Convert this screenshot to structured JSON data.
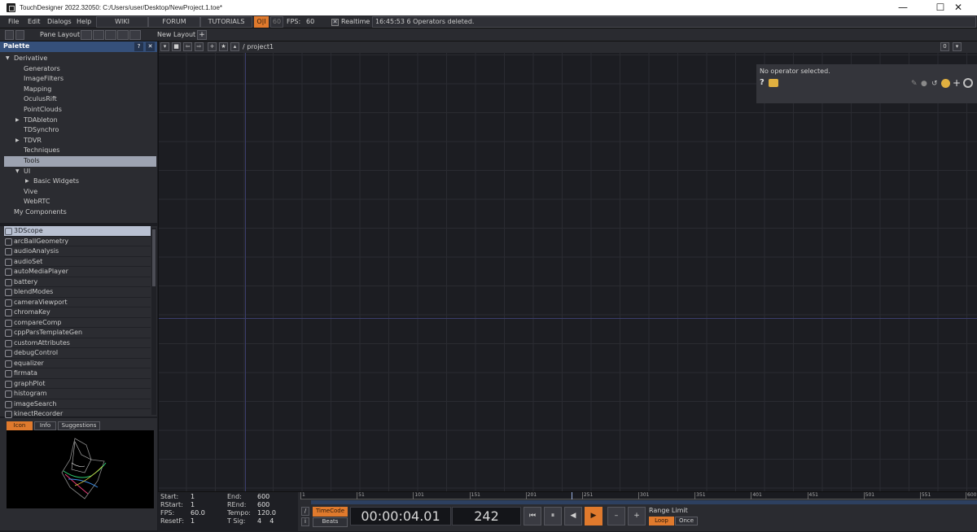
{
  "window": {
    "title": "TouchDesigner 2022.32050: C:/Users/user/Desktop/NewProject.1.toe*",
    "minimize": "—",
    "maximize": "☐",
    "close": "✕"
  },
  "menubar": {
    "items": [
      "File",
      "Edit",
      "Dialogs",
      "Help"
    ],
    "links": [
      "WIKI",
      "FORUM",
      "TUTORIALS"
    ],
    "oi": "O|I",
    "fps_box": "60",
    "fps_label": "FPS:",
    "fps_value": "60",
    "realtime_label": "Realtime",
    "status": "16:45:53 6 Operators deleted."
  },
  "toolbar": {
    "pane_layout": "Pane Layout",
    "new_layout": "New Layout",
    "add": "+"
  },
  "palette": {
    "title": "Palette",
    "help": "?",
    "close": "✕",
    "tree": [
      {
        "label": "Derivative",
        "indent": 0,
        "arrow": "▼"
      },
      {
        "label": "Generators",
        "indent": 1,
        "arrow": ""
      },
      {
        "label": "ImageFilters",
        "indent": 1,
        "arrow": ""
      },
      {
        "label": "Mapping",
        "indent": 1,
        "arrow": ""
      },
      {
        "label": "OculusRift",
        "indent": 1,
        "arrow": ""
      },
      {
        "label": "PointClouds",
        "indent": 1,
        "arrow": ""
      },
      {
        "label": "TDAbleton",
        "indent": 1,
        "arrow": "▶"
      },
      {
        "label": "TDSynchro",
        "indent": 1,
        "arrow": ""
      },
      {
        "label": "TDVR",
        "indent": 1,
        "arrow": "▶"
      },
      {
        "label": "Techniques",
        "indent": 1,
        "arrow": ""
      },
      {
        "label": "Tools",
        "indent": 1,
        "arrow": "",
        "selected": true
      },
      {
        "label": "UI",
        "indent": 1,
        "arrow": "▼"
      },
      {
        "label": "Basic Widgets",
        "indent": 2,
        "arrow": "▶"
      },
      {
        "label": "Vive",
        "indent": 1,
        "arrow": ""
      },
      {
        "label": "WebRTC",
        "indent": 1,
        "arrow": ""
      },
      {
        "label": "My Components",
        "indent": 0,
        "arrow": ""
      }
    ],
    "components": [
      "3DScope",
      "arcBallGeometry",
      "audioAnalysis",
      "audioSet",
      "autoMediaPlayer",
      "battery",
      "blendModes",
      "cameraViewport",
      "chromaKey",
      "compareComp",
      "cppParsTemplateGen",
      "customAttributes",
      "debugControl",
      "equalizer",
      "firmata",
      "graphPlot",
      "histogram",
      "imageSearch",
      "kinectRecorder"
    ],
    "selected_component": "3DScope",
    "tabs": [
      "Icon",
      "Info",
      "Suggestions"
    ],
    "active_tab": "Icon"
  },
  "network": {
    "path": "/ project1",
    "right_count": "0",
    "info_text": "No operator selected.",
    "info_help": "?"
  },
  "timeline": {
    "info": [
      {
        "k": "Start:",
        "v": "1"
      },
      {
        "k": "RStart:",
        "v": "1"
      },
      {
        "k": "FPS:",
        "v": "60.0"
      },
      {
        "k": "ResetF:",
        "v": "1"
      }
    ],
    "info2": [
      {
        "k": "End:",
        "v": "600"
      },
      {
        "k": "REnd:",
        "v": "600"
      },
      {
        "k": "Tempo:",
        "v": "120.0"
      },
      {
        "k": "T Sig:",
        "v": "4    4"
      }
    ],
    "ruler": [
      "1",
      "51",
      "101",
      "151",
      "201",
      "251",
      "301",
      "351",
      "401",
      "451",
      "501",
      "551",
      "600"
    ],
    "timecode_btn": "TimeCode",
    "beats_btn": "Beats",
    "timecode": "00:00:04.01",
    "frame": "242",
    "controls": [
      "⏮",
      "⏸",
      "◀",
      "▶",
      "–",
      "+"
    ],
    "range_label": "Range Limit",
    "loop": "Loop",
    "once": "Once",
    "accent": "#e07a2d"
  }
}
